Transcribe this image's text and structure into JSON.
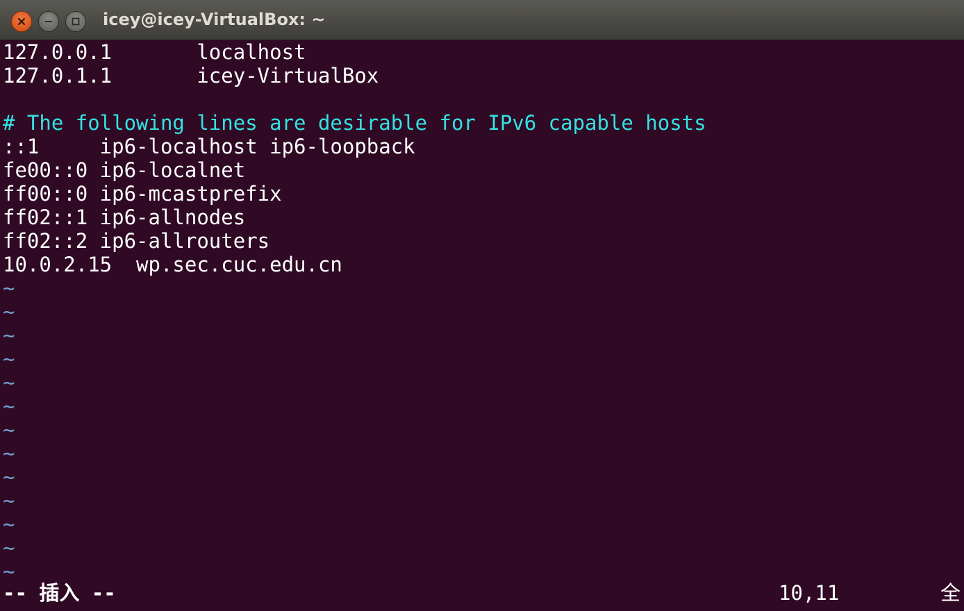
{
  "window": {
    "title": "icey@icey-VirtualBox: ~",
    "close_icon": "close-icon",
    "minimize_icon": "minimize-icon",
    "maximize_icon": "maximize-icon"
  },
  "colors": {
    "background": "#300a24",
    "text": "#ffffff",
    "comment": "#34e2e2",
    "tilde": "#729fcf",
    "close_button": "#e95420"
  },
  "buffer": {
    "lines": [
      "127.0.0.1       localhost",
      "127.0.1.1       icey-VirtualBox",
      "",
      "# The following lines are desirable for IPv6 capable hosts",
      "::1     ip6-localhost ip6-loopback",
      "fe00::0 ip6-localnet",
      "ff00::0 ip6-mcastprefix",
      "ff02::1 ip6-allnodes",
      "ff02::2 ip6-allrouters",
      "10.0.2.15  wp.sec.cuc.edu.cn"
    ],
    "empty_line_marker": "~"
  },
  "statusline": {
    "mode": "-- 插入 --",
    "cursor_position": "10,11",
    "scroll_position": "全"
  }
}
